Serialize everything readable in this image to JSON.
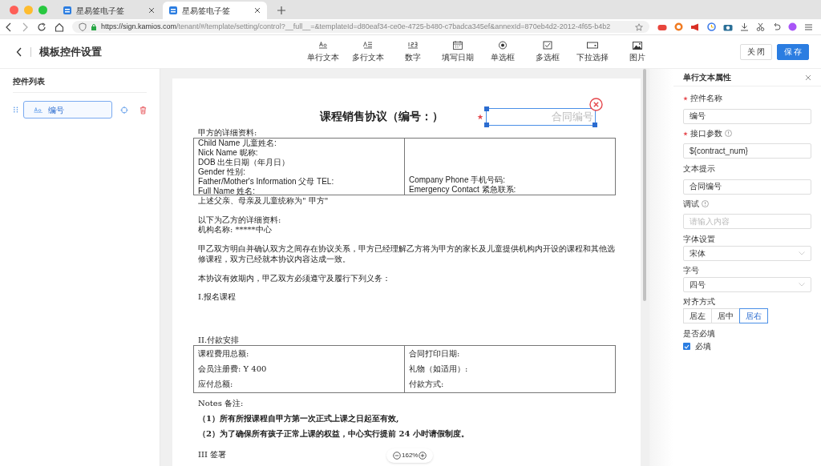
{
  "browser": {
    "tabs": [
      {
        "title": "星易签电子签",
        "selected": false
      },
      {
        "title": "星易签电子签",
        "selected": true
      }
    ],
    "url": {
      "host": "https://sign.kamios.com",
      "path": "/tenant/#/template/setting/control?__full__=&templateId=d80eaf34-ce0e-4725-b480-c7badca345ef&annexId=870eb4d2-2012-4f65-b4b2"
    }
  },
  "header": {
    "title": "模板控件设置",
    "tools": [
      {
        "label": "单行文本",
        "kind": "single_text"
      },
      {
        "label": "多行文本",
        "kind": "multi_text"
      },
      {
        "label": "数字",
        "kind": "number"
      },
      {
        "label": "填写日期",
        "kind": "date"
      },
      {
        "label": "单选框",
        "kind": "radio"
      },
      {
        "label": "多选框",
        "kind": "checkbox"
      },
      {
        "label": "下拉选择",
        "kind": "select"
      },
      {
        "label": "图片",
        "kind": "image"
      }
    ],
    "buttons": [
      {
        "label": "关 闭",
        "kind": "secondary"
      },
      {
        "label": "保 存",
        "kind": "primary"
      }
    ]
  },
  "sidebar": {
    "title": "控件列表",
    "items": [
      {
        "label": "编号",
        "selected": true
      }
    ]
  },
  "document": {
    "title": "课程销售协议（编号：）",
    "field": {
      "placeholder": "合同编号",
      "required": true
    },
    "party_a_label": "甲方的详细资料:",
    "party_a_table": {
      "left": [
        "Child Name 儿童姓名:",
        "Nick Name  昵称:",
        "DOB  出生日期（年月日）",
        "Gender  性别:",
        "Father/Mother's Information  父母 TEL:",
        "Full Name 姓名:"
      ],
      "right": [
        "Company Phone 手机号码:",
        "Emergency Contact 紧急联系:"
      ]
    },
    "party_a_note": "上述父亲、母亲及儿童统称为\" 甲方\"",
    "party_b_label": "以下为乙方的详细资料:",
    "party_b_name": "机构名称: *****中心",
    "paragraphs": [
      "甲乙双方明白并确认双方之间存在协议关系，甲方已经理解乙方将为甲方的家长及儿童提供机构内开设的课程和其他选修课程，双方已经就本协议内容达成一致。",
      "本协议有效期内，甲乙双方必须遵守及履行下列义务："
    ],
    "section_1": "I.报名课程",
    "section_2": "II.付款安排",
    "payment_table": {
      "left": [
        "课程费用总额:",
        "会员注册费:    Y  400",
        "应付总额:"
      ],
      "right": [
        "合同打印日期:",
        "礼物（如适用）:",
        "付款方式:"
      ]
    },
    "notes_label": "Notes  备注:",
    "notes": [
      "（1）所有所报课程自甲方第一次正式上课之日起至有效,",
      "（2）为了确保所有孩子正常上课的权益，中心实行提前 24 小时请假制度。"
    ],
    "section_3": "III 签署"
  },
  "zoom": {
    "value": "162%"
  },
  "properties": {
    "title": "单行文本属性",
    "fields": [
      {
        "label": "控件名称",
        "kind": "input",
        "required": true,
        "info": false,
        "value": "编号"
      },
      {
        "label": "接口参数",
        "kind": "input",
        "required": true,
        "info": true,
        "value": "${contract_num}"
      },
      {
        "label": "文本提示",
        "kind": "input",
        "required": false,
        "info": false,
        "value": "合同编号"
      },
      {
        "label": "调试",
        "kind": "input",
        "required": false,
        "info": true,
        "placeholder": "请输入内容"
      },
      {
        "label": "字体设置",
        "kind": "select",
        "required": false,
        "info": false,
        "value": "宋体"
      },
      {
        "label": "字号",
        "kind": "select",
        "required": false,
        "info": false,
        "value": "四号"
      }
    ],
    "align": {
      "label": "对齐方式",
      "options": [
        {
          "label": "居左",
          "selected": false
        },
        {
          "label": "居中",
          "selected": false
        },
        {
          "label": "居右",
          "selected": true
        }
      ]
    },
    "required_setting": {
      "label": "是否必填",
      "option": "必填",
      "checked": true
    }
  }
}
